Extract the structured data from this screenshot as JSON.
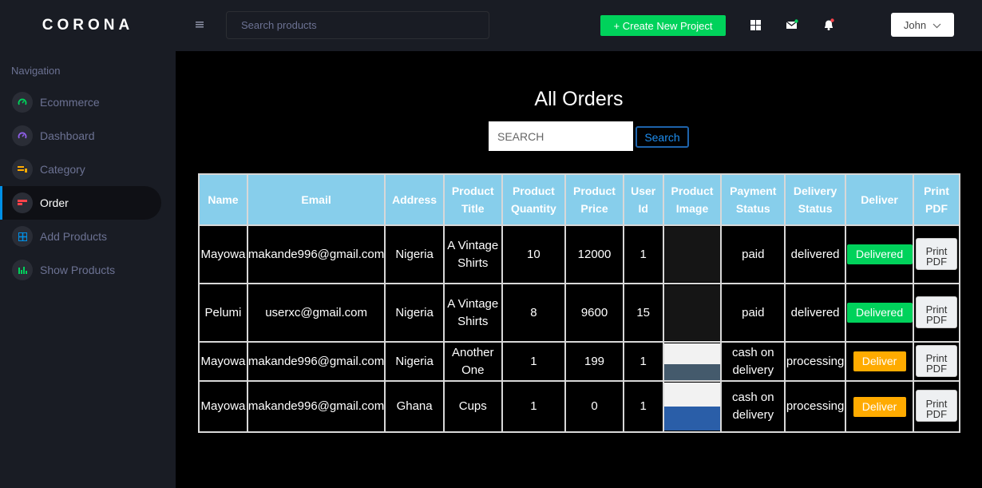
{
  "app": {
    "brand": "CORONA"
  },
  "sidebar": {
    "heading": "Navigation",
    "items": [
      {
        "label": "Ecommerce",
        "icon": "speedometer-icon",
        "color": "#00d25b"
      },
      {
        "label": "Dashboard",
        "icon": "speedometer-icon",
        "color": "#8f5fe8"
      },
      {
        "label": "Category",
        "icon": "playlist-icon",
        "color": "#ffab00"
      },
      {
        "label": "Order",
        "icon": "table-icon",
        "color": "#fc424a",
        "active": true
      },
      {
        "label": "Add Products",
        "icon": "grid-icon",
        "color": "#0090e7"
      },
      {
        "label": "Show Products",
        "icon": "chart-bar-icon",
        "color": "#00d25b"
      }
    ]
  },
  "topbar": {
    "search_placeholder": "Search products",
    "create_label": "+ Create New Project",
    "user_name": "John"
  },
  "main": {
    "title": "All Orders",
    "search_placeholder": "SEARCH",
    "search_button": "Search"
  },
  "table": {
    "headers": [
      "Name",
      "Email",
      "Address",
      "Product Title",
      "Product Quantity",
      "Product Price",
      "User Id",
      "Product Image",
      "Payment Status",
      "Delivery Status",
      "Deliver",
      "Print PDF"
    ],
    "rows": [
      {
        "name": "Mayowa",
        "email": "makande996@gmail.com",
        "address": "Nigeria",
        "title": "A Vintage Shirts",
        "quantity": "10",
        "price": "12000",
        "user_id": "1",
        "payment": "paid",
        "delivery": "delivered",
        "deliver_label": "Delivered",
        "pdf_label": "Print PDF"
      },
      {
        "name": "Pelumi",
        "email": "userxc@gmail.com",
        "address": "Nigeria",
        "title": "A Vintage Shirts",
        "quantity": "8",
        "price": "9600",
        "user_id": "15",
        "payment": "paid",
        "delivery": "delivered",
        "deliver_label": "Delivered",
        "pdf_label": "Print PDF"
      },
      {
        "name": "Mayowa",
        "email": "makande996@gmail.com",
        "address": "Nigeria",
        "title": "Another One",
        "quantity": "1",
        "price": "199",
        "user_id": "1",
        "payment": "cash on delivery",
        "delivery": "processing",
        "deliver_label": "Deliver",
        "pdf_label": "Print PDF"
      },
      {
        "name": "Mayowa",
        "email": "makande996@gmail.com",
        "address": "Ghana",
        "title": "Cups",
        "quantity": "1",
        "price": "0",
        "user_id": "1",
        "payment": "cash on delivery",
        "delivery": "processing",
        "deliver_label": "Deliver",
        "pdf_label": "Print PDF"
      }
    ]
  }
}
